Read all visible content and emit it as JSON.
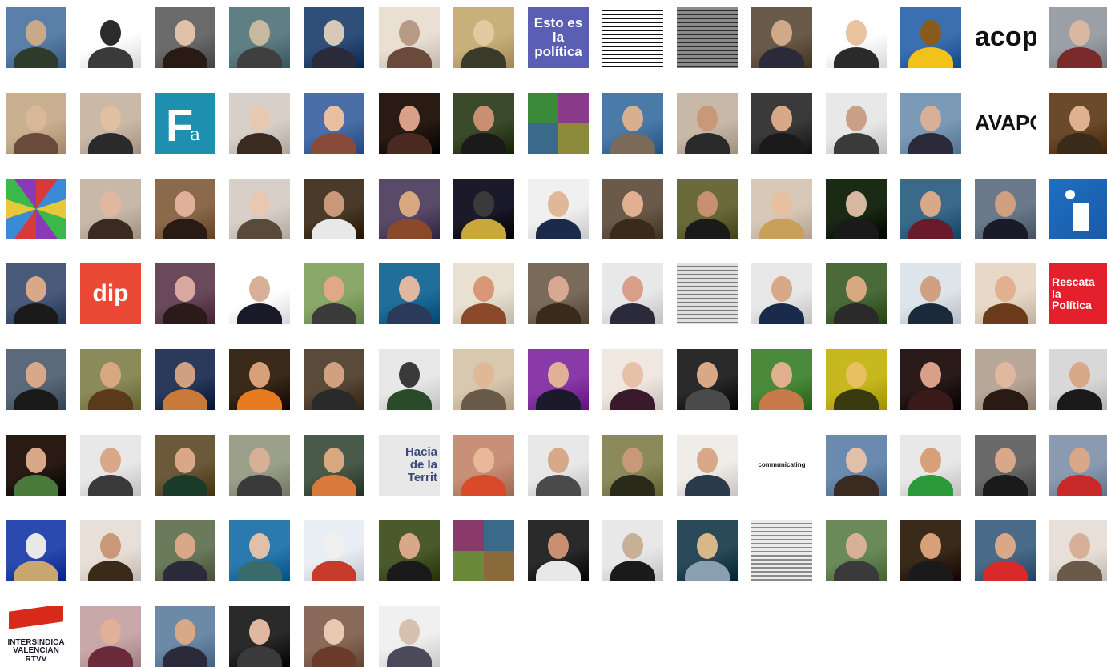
{
  "grid": {
    "columns": 15,
    "tiles": [
      {
        "kind": "photo",
        "colors": [
          "#5a7fa8",
          "#2f3b2a",
          "#c9a98a"
        ],
        "name": "avatar-1"
      },
      {
        "kind": "photo",
        "colors": [
          "#ffffff",
          "#3a3a3a",
          "#2b2b2b"
        ],
        "name": "avatar-2"
      },
      {
        "kind": "photo",
        "colors": [
          "#6b6b6b",
          "#2a1a14",
          "#e0c0a8"
        ],
        "name": "avatar-3"
      },
      {
        "kind": "photo",
        "colors": [
          "#5f7f84",
          "#3f3f3f",
          "#c8b8a0"
        ],
        "name": "avatar-4"
      },
      {
        "kind": "photo",
        "colors": [
          "#2f4f7a",
          "#2a2a3a",
          "#d8c8b8"
        ],
        "name": "avatar-5"
      },
      {
        "kind": "photo",
        "colors": [
          "#e9dfd2",
          "#6a4a3a",
          "#b89a84"
        ],
        "name": "avatar-6"
      },
      {
        "kind": "photo",
        "colors": [
          "#c8b07a",
          "#3a3a2a",
          "#e4c8a0"
        ],
        "name": "avatar-7"
      },
      {
        "kind": "text",
        "bg": "#5b5fb3",
        "fg": "#ffffff",
        "size": 17,
        "text": "Esto es la\npolítica",
        "name": "avatar-8"
      },
      {
        "kind": "stripes",
        "colors": [
          "#ffffff",
          "#111111"
        ],
        "name": "avatar-9"
      },
      {
        "kind": "stripes",
        "colors": [
          "#8a8a8a",
          "#2a2a2a"
        ],
        "name": "avatar-10"
      },
      {
        "kind": "photo",
        "colors": [
          "#6a5a4a",
          "#2a2a3a",
          "#d0a88a"
        ],
        "name": "avatar-11"
      },
      {
        "kind": "photo",
        "colors": [
          "#ffffff",
          "#2a2a2a",
          "#e8c39e"
        ],
        "name": "avatar-12"
      },
      {
        "kind": "photo",
        "colors": [
          "#3a6fb0",
          "#f2c21a",
          "#8a5a1a"
        ],
        "name": "avatar-13"
      },
      {
        "kind": "text",
        "bg": "#ffffff",
        "fg": "#111111",
        "size": 34,
        "text": "acop",
        "name": "avatar-14"
      },
      {
        "kind": "photo",
        "colors": [
          "#9aa0a6",
          "#7a2a2a",
          "#d8b8a0"
        ],
        "name": "avatar-15"
      },
      {
        "kind": "photo",
        "colors": [
          "#c8b090",
          "#6a4a3a",
          "#d8b898"
        ],
        "name": "avatar-16"
      },
      {
        "kind": "photo",
        "colors": [
          "#cbb9a8",
          "#2a2a2a",
          "#e0c0a0"
        ],
        "name": "avatar-17"
      },
      {
        "kind": "fa",
        "bg": "#1f8fb0",
        "name": "avatar-18"
      },
      {
        "kind": "photo",
        "colors": [
          "#d8d0c8",
          "#3a2a20",
          "#e8c8b0"
        ],
        "name": "avatar-19"
      },
      {
        "kind": "photo",
        "colors": [
          "#4a6fa8",
          "#8a4a3a",
          "#e8c0a0"
        ],
        "name": "avatar-20"
      },
      {
        "kind": "photo",
        "colors": [
          "#2a1a14",
          "#4a2a20",
          "#d8a088"
        ],
        "name": "avatar-21"
      },
      {
        "kind": "photo",
        "colors": [
          "#3a4a2a",
          "#1a1a1a",
          "#c89070"
        ],
        "name": "avatar-22"
      },
      {
        "kind": "quad",
        "colors": [
          "#3a8a3a",
          "#8a3a8a",
          "#3a6a8a",
          "#8a8a3a"
        ],
        "name": "avatar-23"
      },
      {
        "kind": "photo",
        "colors": [
          "#4a7aa8",
          "#7a6a5a",
          "#d8b090"
        ],
        "name": "avatar-24"
      },
      {
        "kind": "photo",
        "colors": [
          "#c8b8a8",
          "#2a2a2a",
          "#c89878"
        ],
        "name": "avatar-25"
      },
      {
        "kind": "photo",
        "colors": [
          "#3a3a3a",
          "#1a1a1a",
          "#d8a888"
        ],
        "name": "avatar-26"
      },
      {
        "kind": "photo",
        "colors": [
          "#e8e8e8",
          "#3a3a3a",
          "#c8a088"
        ],
        "name": "avatar-27"
      },
      {
        "kind": "photo",
        "colors": [
          "#7a9ab8",
          "#2a2a3a",
          "#d8b098"
        ],
        "name": "avatar-28"
      },
      {
        "kind": "text",
        "bg": "#ffffff",
        "fg": "#111111",
        "size": 26,
        "text": "AVAPO",
        "name": "avatar-29"
      },
      {
        "kind": "photo",
        "colors": [
          "#6a4a2a",
          "#3a2a1a",
          "#e0b090"
        ],
        "name": "avatar-30"
      },
      {
        "kind": "mosaic",
        "colors": [
          "#d83a3a",
          "#3a8ad8",
          "#e8c83a",
          "#3ab84a",
          "#8a3ab8"
        ],
        "name": "avatar-31"
      },
      {
        "kind": "photo",
        "colors": [
          "#c8b8a8",
          "#3a2a20",
          "#e0b8a0"
        ],
        "name": "avatar-32"
      },
      {
        "kind": "photo",
        "colors": [
          "#8a6a4a",
          "#2a1a14",
          "#e0b098"
        ],
        "name": "avatar-33"
      },
      {
        "kind": "photo",
        "colors": [
          "#d8d0c8",
          "#5a4a3a",
          "#e8c8b0"
        ],
        "name": "avatar-34"
      },
      {
        "kind": "photo",
        "colors": [
          "#4a3a2a",
          "#e8e8e8",
          "#c89878"
        ],
        "name": "avatar-35"
      },
      {
        "kind": "photo",
        "colors": [
          "#5a4a6a",
          "#8a4a2a",
          "#d8a880"
        ],
        "name": "avatar-36"
      },
      {
        "kind": "photo",
        "colors": [
          "#1a1a2a",
          "#c8a83a",
          "#3a3a3a"
        ],
        "name": "avatar-37"
      },
      {
        "kind": "photo",
        "colors": [
          "#f0f0f0",
          "#1a2a4a",
          "#e0b898"
        ],
        "name": "avatar-38"
      },
      {
        "kind": "photo",
        "colors": [
          "#6a5a4a",
          "#3a2a1a",
          "#e0b090"
        ],
        "name": "avatar-39"
      },
      {
        "kind": "photo",
        "colors": [
          "#6a6a3a",
          "#1a1a1a",
          "#c89070"
        ],
        "name": "avatar-40"
      },
      {
        "kind": "photo",
        "colors": [
          "#d8c8b8",
          "#c8a058",
          "#e8c0a0"
        ],
        "name": "avatar-41"
      },
      {
        "kind": "photo",
        "colors": [
          "#1a2a14",
          "#1a1a1a",
          "#d8b8a0"
        ],
        "name": "avatar-42"
      },
      {
        "kind": "photo",
        "colors": [
          "#3a6a8a",
          "#6a1a2a",
          "#d8a888"
        ],
        "name": "avatar-43"
      },
      {
        "kind": "photo",
        "colors": [
          "#6a7a8a",
          "#1a1a2a",
          "#d0a080"
        ],
        "name": "avatar-44"
      },
      {
        "kind": "podium",
        "bg": "#1f6fc0",
        "name": "avatar-45"
      },
      {
        "kind": "photo",
        "colors": [
          "#4a5a7a",
          "#1a1a1a",
          "#d8a888"
        ],
        "name": "avatar-46"
      },
      {
        "kind": "text",
        "bg": "#ea4a35",
        "fg": "#ffffff",
        "size": 30,
        "text": "dip",
        "name": "avatar-47"
      },
      {
        "kind": "photo",
        "colors": [
          "#6a4a5a",
          "#2a1a1a",
          "#d8a8a0"
        ],
        "name": "avatar-48"
      },
      {
        "kind": "photo",
        "colors": [
          "#ffffff",
          "#1a1a2a",
          "#d8b098"
        ],
        "name": "avatar-49"
      },
      {
        "kind": "photo",
        "colors": [
          "#8aa86a",
          "#3a3a3a",
          "#e0a888"
        ],
        "name": "avatar-50"
      },
      {
        "kind": "photo",
        "colors": [
          "#1f6f9a",
          "#2a3a5a",
          "#e0b8a0"
        ],
        "name": "avatar-51"
      },
      {
        "kind": "photo",
        "colors": [
          "#e8e0d0",
          "#8a4a2a",
          "#d89878"
        ],
        "name": "avatar-52"
      },
      {
        "kind": "photo",
        "colors": [
          "#7a6a5a",
          "#3a2a1a",
          "#d8a890"
        ],
        "name": "avatar-53"
      },
      {
        "kind": "photo",
        "colors": [
          "#e8e8e8",
          "#2a2a3a",
          "#d8a088"
        ],
        "name": "avatar-54"
      },
      {
        "kind": "stripes",
        "colors": [
          "#e0e0e0",
          "#7a7a7a"
        ],
        "name": "avatar-55"
      },
      {
        "kind": "photo",
        "colors": [
          "#e8e8e8",
          "#1a2a4a",
          "#d8a888"
        ],
        "name": "avatar-56"
      },
      {
        "kind": "photo",
        "colors": [
          "#4a6a3a",
          "#2a2a2a",
          "#d8a880"
        ],
        "name": "avatar-57"
      },
      {
        "kind": "photo",
        "colors": [
          "#dde4ea",
          "#1a2a3a",
          "#d0a080"
        ],
        "name": "avatar-58"
      },
      {
        "kind": "photo",
        "colors": [
          "#e8d8c8",
          "#6a3a1a",
          "#e0b090"
        ],
        "name": "avatar-59"
      },
      {
        "kind": "text",
        "bg": "#e3202c",
        "fg": "#ffffff",
        "size": 14,
        "text": "Rescata\nla\nPolítica",
        "align": "left",
        "name": "avatar-60"
      },
      {
        "kind": "photo",
        "colors": [
          "#5a6a7a",
          "#1a1a1a",
          "#d8a888"
        ],
        "name": "avatar-61"
      },
      {
        "kind": "photo",
        "colors": [
          "#8a8a5a",
          "#5a3a1a",
          "#d8a880"
        ],
        "name": "avatar-62"
      },
      {
        "kind": "photo",
        "colors": [
          "#2a3a5a",
          "#c87a3a",
          "#d0a080"
        ],
        "name": "avatar-63"
      },
      {
        "kind": "photo",
        "colors": [
          "#3a2a1a",
          "#e87a20",
          "#d8a078"
        ],
        "name": "avatar-64"
      },
      {
        "kind": "photo",
        "colors": [
          "#5a4a3a",
          "#2a2a2a",
          "#d0a080"
        ],
        "name": "avatar-65"
      },
      {
        "kind": "photo",
        "colors": [
          "#e8e8e8",
          "#2a4a2a",
          "#3a3a3a"
        ],
        "name": "avatar-66"
      },
      {
        "kind": "photo",
        "colors": [
          "#d8c8b0",
          "#6a5a4a",
          "#e0b898"
        ],
        "name": "avatar-67"
      },
      {
        "kind": "photo",
        "colors": [
          "#8a3aa8",
          "#1a1a2a",
          "#e0b098"
        ],
        "name": "avatar-68"
      },
      {
        "kind": "photo",
        "colors": [
          "#f0e8e0",
          "#3a1a2a",
          "#e8c0a8"
        ],
        "name": "avatar-69"
      },
      {
        "kind": "photo",
        "colors": [
          "#2a2a2a",
          "#4a4a4a",
          "#d8a888"
        ],
        "name": "avatar-70"
      },
      {
        "kind": "photo",
        "colors": [
          "#4a8a3a",
          "#c87a4a",
          "#e0b090"
        ],
        "name": "avatar-71"
      },
      {
        "kind": "photo",
        "colors": [
          "#c8b820",
          "#3a3a10",
          "#e8c060"
        ],
        "name": "avatar-72"
      },
      {
        "kind": "photo",
        "colors": [
          "#2a1a1a",
          "#3a1a1a",
          "#d8a088"
        ],
        "name": "avatar-73"
      },
      {
        "kind": "photo",
        "colors": [
          "#b8a89a",
          "#2a1a14",
          "#e0b8a0"
        ],
        "name": "avatar-74"
      },
      {
        "kind": "photo",
        "colors": [
          "#d8d8d8",
          "#1a1a1a",
          "#d8a888"
        ],
        "name": "avatar-75"
      },
      {
        "kind": "photo",
        "colors": [
          "#2a1a14",
          "#4a7a3a",
          "#d8a888"
        ],
        "name": "avatar-76"
      },
      {
        "kind": "photo",
        "colors": [
          "#e8e8e8",
          "#3a3a3a",
          "#d8a888"
        ],
        "name": "avatar-77"
      },
      {
        "kind": "photo",
        "colors": [
          "#6a5a3a",
          "#1a3a2a",
          "#d8a888"
        ],
        "name": "avatar-78"
      },
      {
        "kind": "photo",
        "colors": [
          "#9aa08a",
          "#3a3a3a",
          "#d8b098"
        ],
        "name": "avatar-79"
      },
      {
        "kind": "photo",
        "colors": [
          "#4a5a4a",
          "#d87a3a",
          "#d8a880"
        ],
        "name": "avatar-80"
      },
      {
        "kind": "text",
        "bg": "#e8e8e8",
        "fg": "#3a4a7a",
        "size": 15,
        "text": "Hacia\nde la Territ",
        "align": "right",
        "name": "avatar-81"
      },
      {
        "kind": "photo",
        "colors": [
          "#c89078",
          "#d84a2a",
          "#e8b898"
        ],
        "name": "avatar-82"
      },
      {
        "kind": "photo",
        "colors": [
          "#e8e8e8",
          "#4a4a4a",
          "#d8a888"
        ],
        "name": "avatar-83"
      },
      {
        "kind": "photo",
        "colors": [
          "#8a8a5a",
          "#2a2a1a",
          "#c89878"
        ],
        "name": "avatar-84"
      },
      {
        "kind": "photo",
        "colors": [
          "#f0ece8",
          "#2a3a4a",
          "#d8a888"
        ],
        "name": "avatar-85"
      },
      {
        "kind": "text",
        "bg": "#ffffff",
        "fg": "#111111",
        "size": 8,
        "text": "communicating",
        "name": "avatar-86"
      },
      {
        "kind": "photo",
        "colors": [
          "#6a8ab0",
          "#3a2a20",
          "#e0c0a8"
        ],
        "name": "avatar-87"
      },
      {
        "kind": "photo",
        "colors": [
          "#e8e8e8",
          "#2a9a3a",
          "#d8a078"
        ],
        "name": "avatar-88"
      },
      {
        "kind": "photo",
        "colors": [
          "#6a6a6a",
          "#1a1a1a",
          "#d8a888"
        ],
        "name": "avatar-89"
      },
      {
        "kind": "photo",
        "colors": [
          "#8a9ab0",
          "#c82a2a",
          "#d8a888"
        ],
        "name": "avatar-90"
      },
      {
        "kind": "photo",
        "colors": [
          "#2a4ab0",
          "#c8a870",
          "#e8e8e8"
        ],
        "name": "avatar-91"
      },
      {
        "kind": "photo",
        "colors": [
          "#e8e0d8",
          "#3a2a1a",
          "#c89878"
        ],
        "name": "avatar-92"
      },
      {
        "kind": "photo",
        "colors": [
          "#6a7a5a",
          "#2a2a3a",
          "#d8a888"
        ],
        "name": "avatar-93"
      },
      {
        "kind": "photo",
        "colors": [
          "#2a7ab0",
          "#3a6a6a",
          "#e0c0a8"
        ],
        "name": "avatar-94"
      },
      {
        "kind": "photo",
        "colors": [
          "#e8eef4",
          "#c83a2a",
          "#f0f0f0"
        ],
        "name": "avatar-95"
      },
      {
        "kind": "photo",
        "colors": [
          "#4a5a2a",
          "#1a1a1a",
          "#d8a888"
        ],
        "name": "avatar-96"
      },
      {
        "kind": "quad",
        "colors": [
          "#8a3a6a",
          "#3a6a8a",
          "#6a8a3a",
          "#8a6a3a"
        ],
        "name": "avatar-97"
      },
      {
        "kind": "photo",
        "colors": [
          "#2a2a2a",
          "#e8e8e8",
          "#c89070"
        ],
        "name": "avatar-98"
      },
      {
        "kind": "photo",
        "colors": [
          "#e8e8e8",
          "#1a1a1a",
          "#c8b098"
        ],
        "name": "avatar-99"
      },
      {
        "kind": "photo",
        "colors": [
          "#2a4a5a",
          "#8aa0b0",
          "#d8b888"
        ],
        "name": "avatar-100"
      },
      {
        "kind": "stripes",
        "colors": [
          "#ececec",
          "#8a8a8a"
        ],
        "name": "avatar-101"
      },
      {
        "kind": "photo",
        "colors": [
          "#6a8a5a",
          "#3a3a3a",
          "#d8b098"
        ],
        "name": "avatar-102"
      },
      {
        "kind": "photo",
        "colors": [
          "#3a2a1a",
          "#1a1a1a",
          "#d8a078"
        ],
        "name": "avatar-103"
      },
      {
        "kind": "photo",
        "colors": [
          "#4a6a8a",
          "#d82a2a",
          "#d8a888"
        ],
        "name": "avatar-104"
      },
      {
        "kind": "photo",
        "colors": [
          "#e8e0d8",
          "#6a5a4a",
          "#d8b098"
        ],
        "name": "avatar-105"
      },
      {
        "kind": "text",
        "bg": "#ffffff",
        "fg": "#1a1a2a",
        "size": 10,
        "text": "INTERSINDICA\nVALENCIAN\nRTVV",
        "banner": "#d82a1a",
        "name": "avatar-106"
      },
      {
        "kind": "photo",
        "colors": [
          "#c8a8a8",
          "#6a2a3a",
          "#e0b098"
        ],
        "name": "avatar-107"
      },
      {
        "kind": "photo",
        "colors": [
          "#6a8aa8",
          "#2a2a3a",
          "#d8a888"
        ],
        "name": "avatar-108"
      },
      {
        "kind": "photo",
        "colors": [
          "#2a2a2a",
          "#3a3a3a",
          "#e0b8a0"
        ],
        "name": "avatar-109"
      },
      {
        "kind": "photo",
        "colors": [
          "#8a6a5a",
          "#6a3a2a",
          "#e8c8b0"
        ],
        "name": "avatar-110"
      },
      {
        "kind": "photo",
        "colors": [
          "#f0f0f0",
          "#4a4a5a",
          "#d8c0b0"
        ],
        "name": "avatar-111"
      }
    ]
  }
}
